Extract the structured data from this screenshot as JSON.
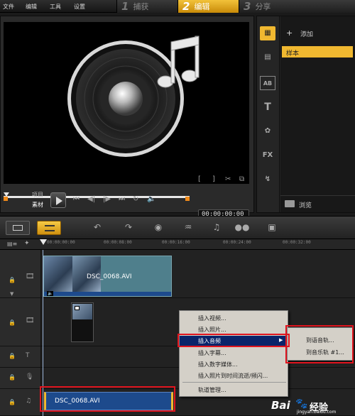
{
  "menu": {
    "file": "文件",
    "edit": "编辑",
    "tools": "工具",
    "settings": "设置"
  },
  "steps": [
    {
      "num": "1",
      "label": "捕获"
    },
    {
      "num": "2",
      "label": "编辑"
    },
    {
      "num": "3",
      "label": "分享"
    }
  ],
  "player": {
    "mode_project": "项目",
    "mode_clip": "素材",
    "timecode": "00:00:00:00",
    "mark_in": "[",
    "mark_out": "]"
  },
  "library": {
    "add_label": "添加",
    "folder_sample": "样本",
    "browse_label": "浏览",
    "fx_tab": "FX",
    "text_tab": "T"
  },
  "ruler": {
    "ticks": [
      "00:00:00:00",
      "00:00:08:00",
      "00:00:16:00",
      "00:00:24:00",
      "00:00:32:00"
    ]
  },
  "video_track": {
    "clip_name": "DSC_0068.AVI"
  },
  "music_track": {
    "clip_name": "DSC_0068.AVI"
  },
  "context_menu": {
    "items": [
      "插入视频...",
      "插入照片...",
      "插入音频",
      "插入字幕...",
      "插入数字媒体...",
      "插入照片到时间流逝/频闪...",
      "轨道管理..."
    ]
  },
  "submenu": {
    "items": [
      "到语音轨...",
      "到音乐轨 #1..."
    ]
  },
  "watermark": {
    "brand": "Bai",
    "brand2": "经验",
    "url": "jingyan.baidu.com"
  },
  "colors": {
    "accent": "#f0b830",
    "highlight_box": "#e0141e",
    "clip_blue": "#1d4a8c"
  }
}
